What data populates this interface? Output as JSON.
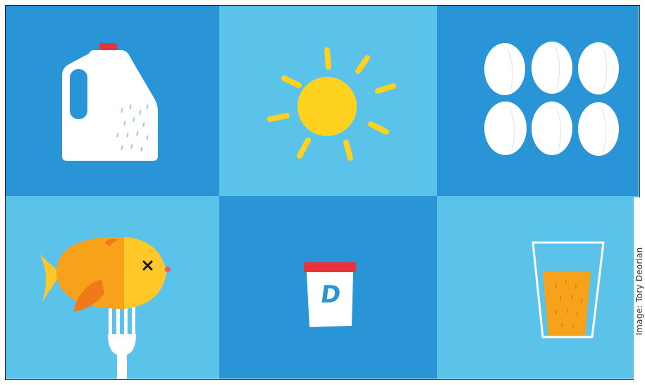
{
  "colors": {
    "tile_dark": "#2A95D6",
    "tile_light": "#5BC3EA",
    "sun": "#FFD21F",
    "white": "#FFFFFF",
    "cap_red": "#E8333A",
    "fish_orange": "#F8A21C",
    "fish_yellow": "#FFC727",
    "fin_dark_orange": "#F07A1A",
    "juice": "#F7A21B"
  },
  "tiles": [
    {
      "icon": "milk-jug-icon"
    },
    {
      "icon": "sun-icon"
    },
    {
      "icon": "eggs-icon"
    },
    {
      "icon": "fish-on-fork-icon"
    },
    {
      "icon": "vitamin-d-bottle-icon",
      "label": "D"
    },
    {
      "icon": "orange-juice-glass-icon"
    }
  ],
  "credit": "Image: Tory Deorian"
}
